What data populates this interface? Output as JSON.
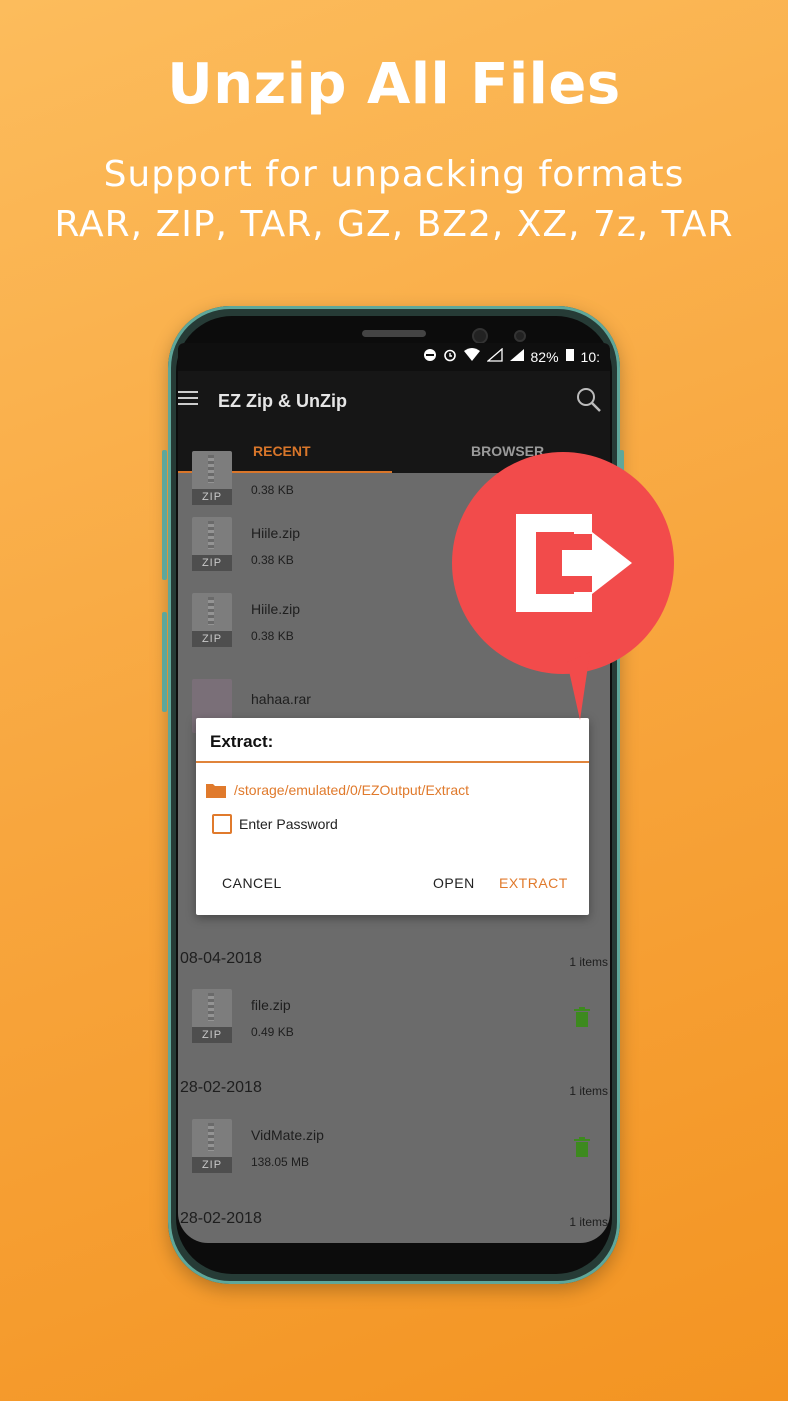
{
  "promo": {
    "headline": "Unzip All Files",
    "subline1": "Support for unpacking formats",
    "subline2": "RAR, ZIP, TAR, GZ, BZ2, XZ, 7z, TAR"
  },
  "status_bar": {
    "battery": "82%",
    "time": "10:"
  },
  "app_bar": {
    "title": "EZ Zip & UnZip"
  },
  "tabs": {
    "recent": "RECENT",
    "browser": "BROWSER"
  },
  "list": {
    "rows": [
      {
        "name": "",
        "size": "0.38 KB",
        "icon_label": "ZIP"
      },
      {
        "name": "Hiile.zip",
        "size": "0.38 KB",
        "icon_label": "ZIP"
      },
      {
        "name": "Hiile.zip",
        "size": "0.38 KB",
        "icon_label": "ZIP"
      },
      {
        "name": "hahaa.rar",
        "size": "",
        "icon_label": ""
      }
    ],
    "groups": [
      {
        "date": "08-04-2018",
        "count": "1 items",
        "file": {
          "name": "file.zip",
          "size": "0.49 KB",
          "icon_label": "ZIP"
        }
      },
      {
        "date": "28-02-2018",
        "count": "1 items",
        "file": {
          "name": "VidMate.zip",
          "size": "138.05 MB",
          "icon_label": "ZIP"
        }
      },
      {
        "date": "28-02-2018",
        "count": "1 items"
      }
    ]
  },
  "dialog": {
    "title": "Extract:",
    "path": "/storage/emulated/0/EZOutput/Extract",
    "password_label": "Enter Password",
    "cancel": "CANCEL",
    "open": "OPEN",
    "extract": "EXTRACT"
  },
  "colors": {
    "accent": "#e07a2c",
    "badge": "#f24b4b",
    "trash": "#3d8a1e"
  },
  "icons": [
    "hamburger-icon",
    "search-icon",
    "zip-file-icon",
    "trash-icon",
    "folder-icon",
    "exit-arrow-icon"
  ]
}
